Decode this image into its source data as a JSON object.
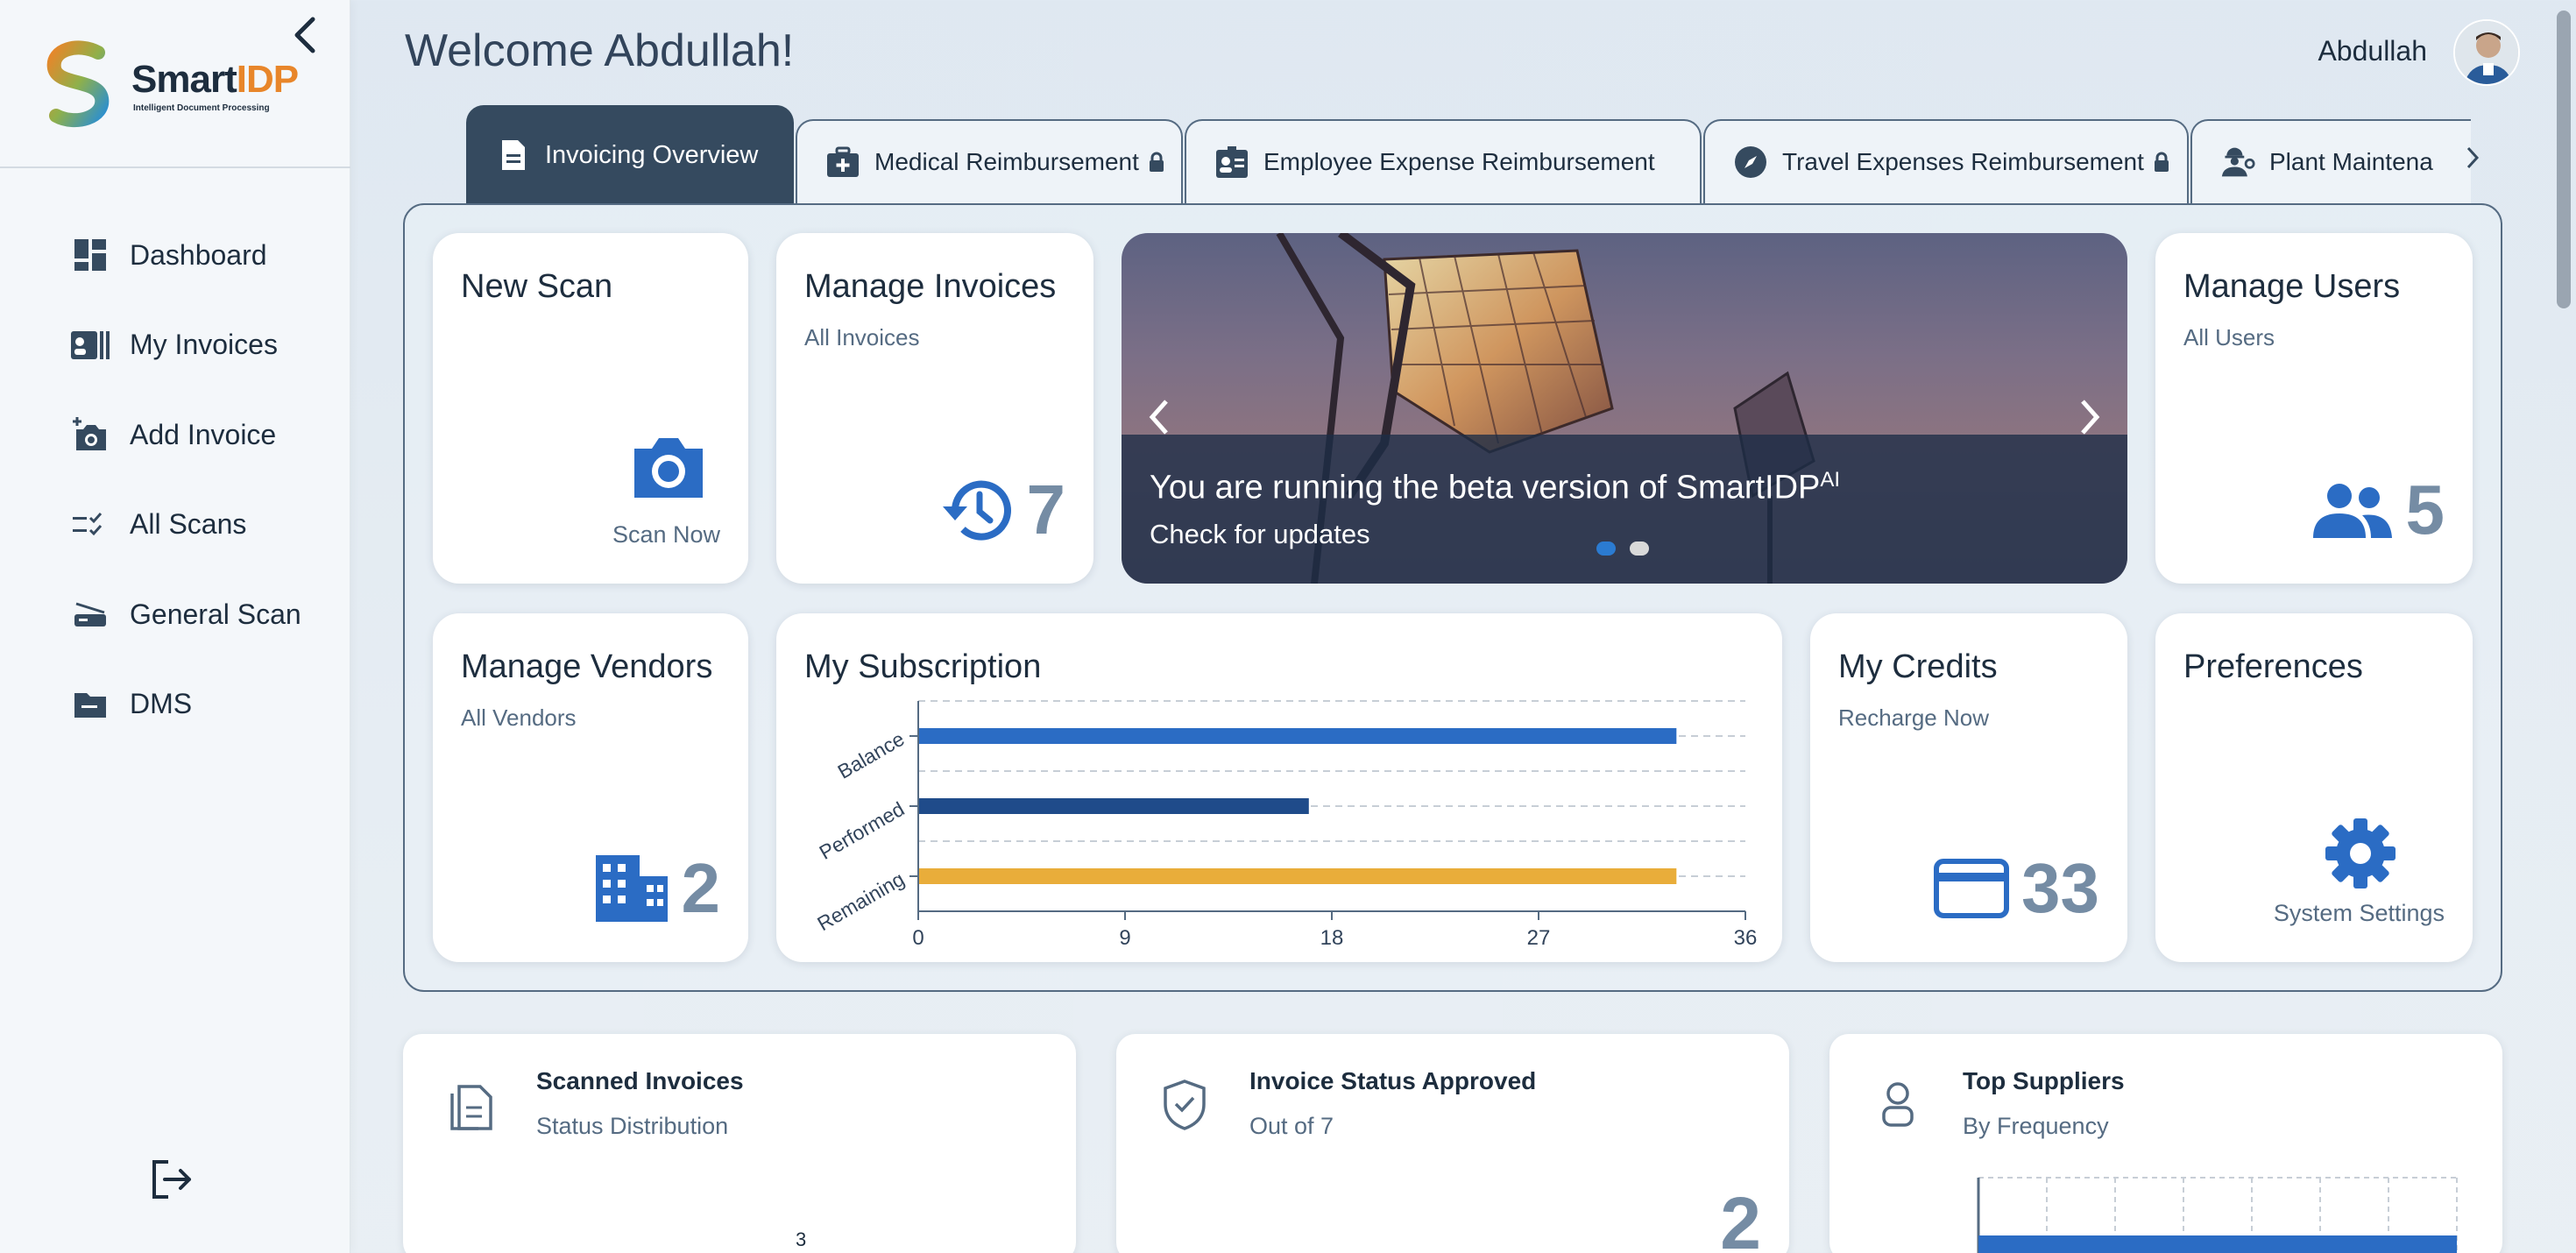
{
  "app": {
    "logo_main": "Smart",
    "logo_accent": "IDP",
    "logo_sub": "Intelligent Document Processing"
  },
  "header": {
    "welcome": "Welcome Abdullah!",
    "user_name": "Abdullah"
  },
  "sidebar": {
    "items": [
      {
        "label": "Dashboard",
        "icon": "dashboard-icon"
      },
      {
        "label": "My Invoices",
        "icon": "invoices-icon"
      },
      {
        "label": "Add Invoice",
        "icon": "add-photo-icon"
      },
      {
        "label": "All Scans",
        "icon": "checklist-icon"
      },
      {
        "label": "General Scan",
        "icon": "scanner-icon"
      },
      {
        "label": "DMS",
        "icon": "folder-icon"
      }
    ]
  },
  "tabs": [
    {
      "label": "Invoicing Overview",
      "locked": false,
      "active": true
    },
    {
      "label": "Medical Reimbursement",
      "locked": true
    },
    {
      "label": "Employee Expense Reimbursement",
      "locked": false
    },
    {
      "label": "Travel Expenses Reimbursement",
      "locked": true
    },
    {
      "label": "Plant Maintena",
      "locked": false
    }
  ],
  "cards": {
    "new_scan": {
      "title": "New Scan",
      "action": "Scan Now"
    },
    "manage_invoices": {
      "title": "Manage Invoices",
      "subtitle": "All Invoices",
      "count": "7"
    },
    "manage_users": {
      "title": "Manage Users",
      "subtitle": "All Users",
      "count": "5"
    },
    "manage_vendors": {
      "title": "Manage Vendors",
      "subtitle": "All Vendors",
      "count": "2"
    },
    "subscription": {
      "title": "My Subscription"
    },
    "credits": {
      "title": "My Credits",
      "subtitle": "Recharge Now",
      "count": "33"
    },
    "preferences": {
      "title": "Preferences",
      "action": "System Settings"
    }
  },
  "carousel": {
    "line1": "You are running the beta version of SmartIDP",
    "line1_sup": "AI",
    "line2": "Check for updates",
    "slides": 2,
    "active_slide": 0
  },
  "bottom_cards": [
    {
      "title": "Scanned Invoices",
      "subtitle": "Status Distribution",
      "value": "3"
    },
    {
      "title": "Invoice Status Approved",
      "subtitle": "Out of 7",
      "value": "2"
    },
    {
      "title": "Top Suppliers",
      "subtitle": "By Frequency"
    }
  ],
  "colors": {
    "accent_blue": "#2b6cc4",
    "navy": "#1f4b8a",
    "gold": "#e9ad3a",
    "tab_active": "#354a5f",
    "kpi_grey": "#758ca4"
  },
  "chart_data": {
    "type": "bar",
    "orientation": "horizontal",
    "categories": [
      "Balance",
      "Performed",
      "Remaining"
    ],
    "values": [
      33,
      17,
      33
    ],
    "colors": [
      "#2b6cc4",
      "#1f4b8a",
      "#e9ad3a"
    ],
    "xticks": [
      0,
      9,
      18,
      27,
      36
    ],
    "xlim": [
      0,
      36
    ]
  }
}
